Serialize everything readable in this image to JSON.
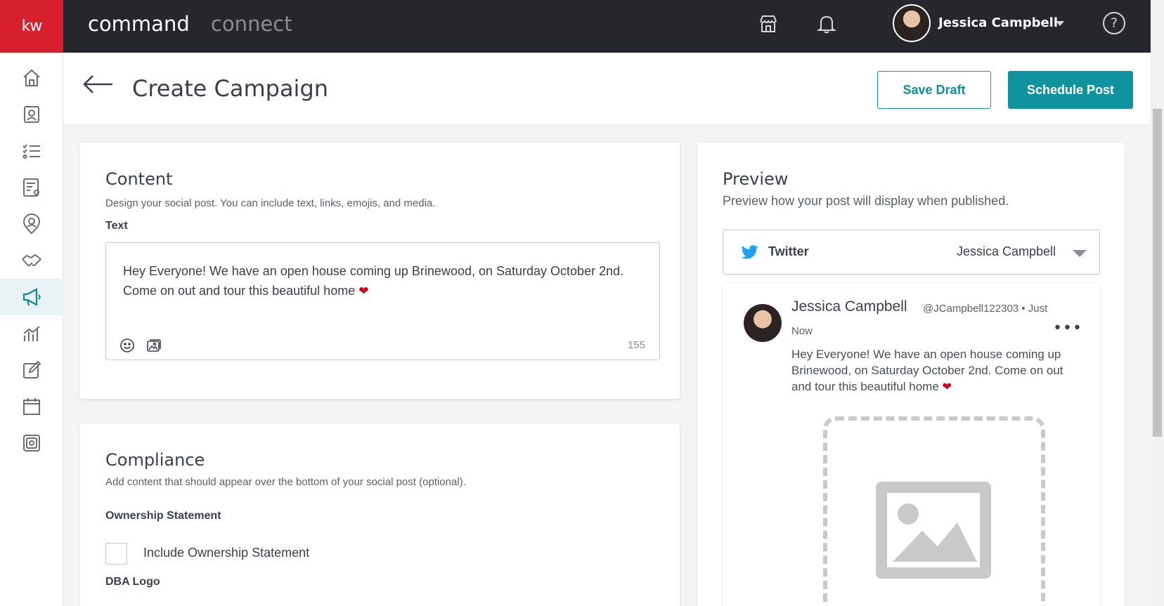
{
  "topbar": {
    "logo": "kw",
    "brand_primary": "command",
    "brand_secondary": "connect",
    "user_name": "Jessica Campbell",
    "help_label": "?",
    "icons": [
      "store-icon",
      "bell-icon",
      "chevron-down-icon",
      "help-icon"
    ]
  },
  "sidebar": {
    "items": [
      {
        "name": "home-icon"
      },
      {
        "name": "contacts-icon"
      },
      {
        "name": "tasks-icon"
      },
      {
        "name": "checklist-settings-icon"
      },
      {
        "name": "user-pin-icon"
      },
      {
        "name": "handshake-icon"
      },
      {
        "name": "megaphone-icon",
        "active": true
      },
      {
        "name": "analytics-icon"
      },
      {
        "name": "edit-icon"
      },
      {
        "name": "calendar-icon"
      },
      {
        "name": "photo-library-icon"
      }
    ]
  },
  "header": {
    "title": "Create Campaign",
    "save_draft": "Save Draft",
    "schedule_post": "Schedule Post"
  },
  "content_card": {
    "title": "Content",
    "subtitle": "Design your social post. You can include text, links, emojis, and media.",
    "text_label": "Text",
    "text_value": "Hey Everyone! We have an open house coming up Brinewood, on Saturday October 2nd. Come on out and tour this beautiful home",
    "char_count": "155"
  },
  "compliance_card": {
    "title": "Compliance",
    "subtitle": "Add content that should appear over the bottom of your social post (optional).",
    "ownership_label": "Ownership Statement",
    "ownership_checkbox": "Include Ownership Statement",
    "dba_label": "DBA Logo"
  },
  "preview_card": {
    "title": "Preview",
    "subtitle": "Preview how your post will display when published.",
    "platform": "Twitter",
    "account": "Jessica Campbell",
    "post": {
      "name": "Jessica Campbell",
      "handle": "@JCampbell122303 • Just",
      "time": "Now",
      "text": "Hey Everyone! We have an open house coming up Brinewood, on Saturday October 2nd. Come on out and tour this beautiful home"
    }
  },
  "colors": {
    "topbar": "#25272d",
    "brand_red": "#d71f2e",
    "accent_teal": "#0f949f",
    "active_sidebar": "#e9f3f5"
  }
}
